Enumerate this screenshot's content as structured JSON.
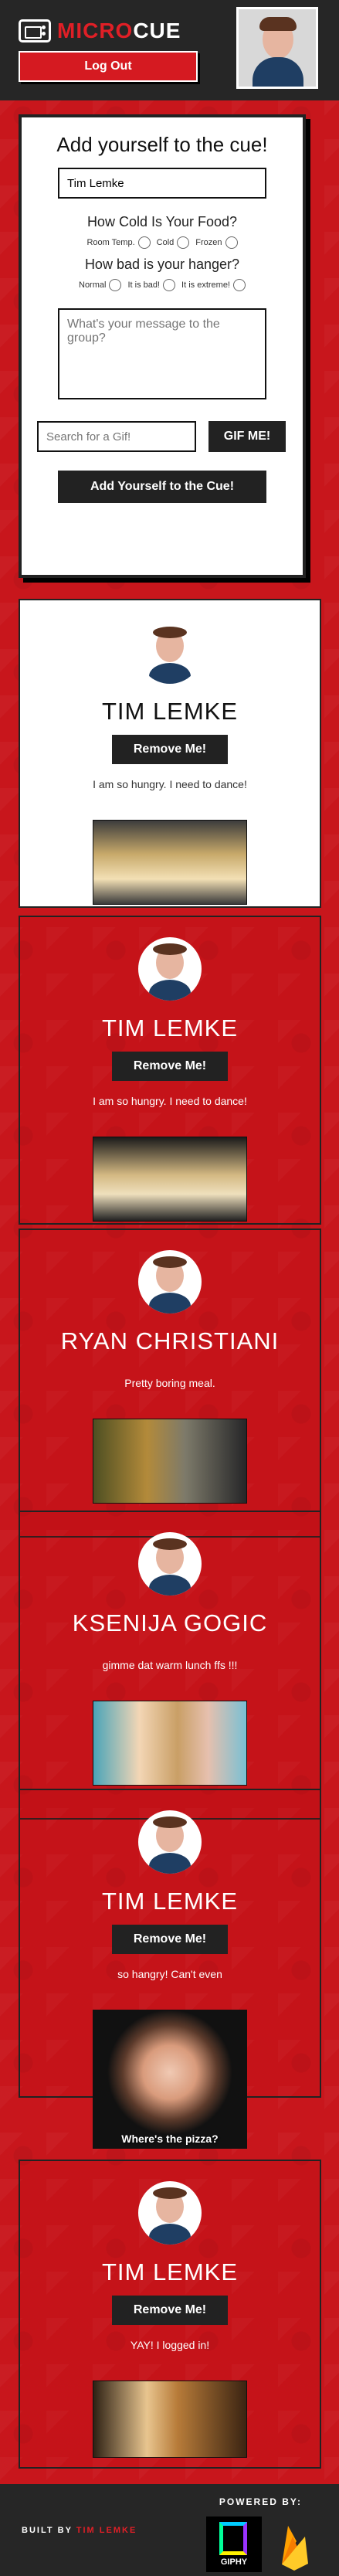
{
  "app": {
    "logo_red": "MICRO",
    "logo_white": "CUE",
    "logout_label": "Log Out"
  },
  "form": {
    "title": "Add yourself to the cue!",
    "name_value": "Tim Lemke",
    "food_question": "How Cold Is Your Food?",
    "food_options": [
      "Room Temp.",
      "Cold",
      "Frozen"
    ],
    "hanger_question": "How bad is your hanger?",
    "hanger_options": [
      "Normal",
      "It is bad!",
      "It is extreme!"
    ],
    "message_placeholder": "What's your message to the group?",
    "gif_placeholder": "Search for a Gif!",
    "gif_button": "GIF ME!",
    "submit_button": "Add Yourself to the Cue!"
  },
  "entries": [
    {
      "name": "TIM LEMKE",
      "button": "Remove Me!",
      "message": "I am so hungry. I need to dance!",
      "gif_caption": ""
    },
    {
      "name": "TIM LEMKE",
      "button": "Remove Me!",
      "message": "I am so hungry. I need to dance!",
      "gif_caption": ""
    },
    {
      "name": "RYAN CHRISTIANI",
      "button": "",
      "message": "Pretty boring meal.",
      "gif_caption": ""
    },
    {
      "name": "KSENIJA GOGIC",
      "button": "",
      "message": "gimme dat warm lunch ffs !!!",
      "gif_caption": ""
    },
    {
      "name": "TIM LEMKE",
      "button": "Remove Me!",
      "message": "so hangry! Can't even",
      "gif_caption": "Where's the pizza?"
    },
    {
      "name": "TIM LEMKE",
      "button": "Remove Me!",
      "message": "YAY! I logged in!",
      "gif_caption": ""
    }
  ],
  "footer": {
    "built_prefix": "BUILT BY",
    "built_name": "TIM LEMKE",
    "powered_by": "POWERED BY:",
    "giphy": "GIPHY"
  }
}
